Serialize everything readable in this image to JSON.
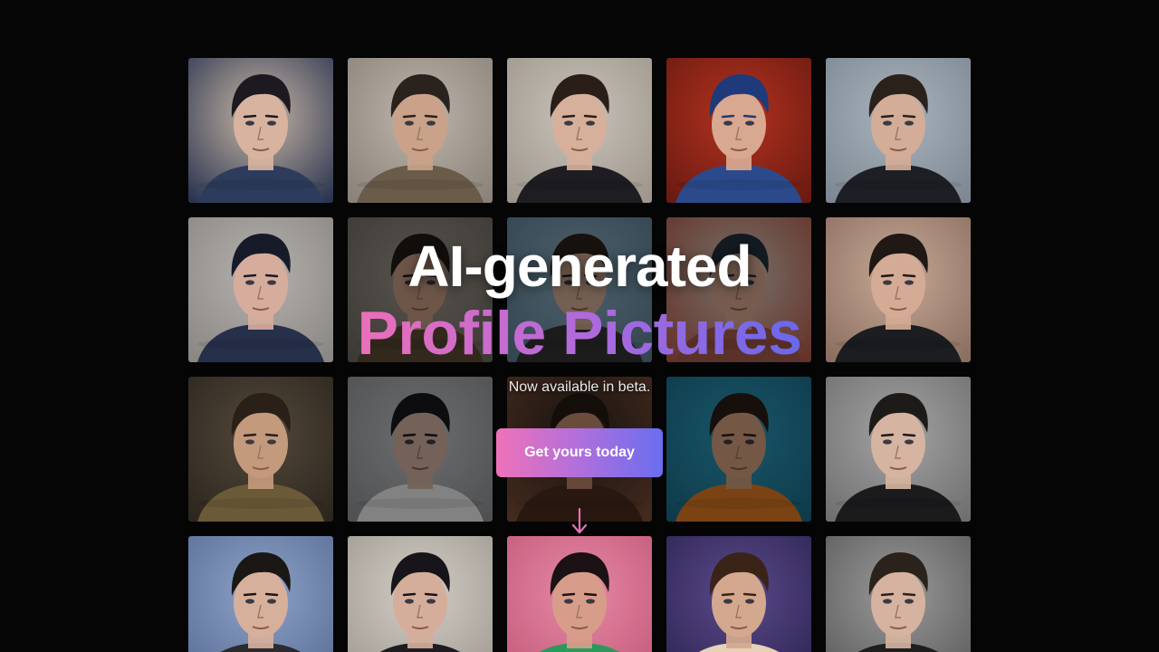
{
  "hero": {
    "title_line1": "AI-generated",
    "title_line2": "Profile Pictures",
    "subtitle": "Now available in beta.",
    "cta_label": "Get yours today",
    "arrow_icon": "arrow-down-icon",
    "gradient": [
      "#ec6fb9",
      "#b86ad8",
      "#6a68ec"
    ]
  },
  "portraits": [
    {
      "bg": "#c9b8a6",
      "bg2": "#2a3450",
      "skin": "#d8b4a0",
      "hair": "#1c1a20",
      "shirt": "#2d3c5c"
    },
    {
      "bg": "#bdb6ad",
      "bg2": "#8a8178",
      "skin": "#c9a289",
      "hair": "#2a221c",
      "shirt": "#6b5c4a"
    },
    {
      "bg": "#c8c2ba",
      "bg2": "#9e968c",
      "skin": "#d6b09a",
      "hair": "#2a1f18",
      "shirt": "#1e1e22"
    },
    {
      "bg": "#b3321e",
      "bg2": "#6a1a12",
      "skin": "#d9a890",
      "hair": "#1f3a7a",
      "shirt": "#2b4a8c"
    },
    {
      "bg": "#a9b3bd",
      "bg2": "#7d8792",
      "skin": "#d3ad98",
      "hair": "#2b211b",
      "shirt": "#1d1f24"
    },
    {
      "bg": "#b4b1ae",
      "bg2": "#8a8683",
      "skin": "#d6ad9c",
      "hair": "#171a28",
      "shirt": "#26304a"
    },
    {
      "bg": "#9f988f",
      "bg2": "#6e675f",
      "skin": "#c79c83",
      "hair": "#201a15",
      "shirt": "#5a4a33"
    },
    {
      "bg": "#8fb0c2",
      "bg2": "#5a7d92",
      "skin": "#d3ad95",
      "hair": "#2a2018",
      "shirt": "#333"
    },
    {
      "bg": "#d9cdbf",
      "bg2": "#b65a4a",
      "skin": "#d7a88f",
      "hair": "#23303c",
      "shirt": "#a65a4a"
    },
    {
      "bg": "#c7a896",
      "bg2": "#8a6e60",
      "skin": "#d4ab95",
      "hair": "#1f1814",
      "shirt": "#1c1d20"
    },
    {
      "bg": "#54483a",
      "bg2": "#2c261e",
      "skin": "#c49a7c",
      "hair": "#2a2017",
      "shirt": "#6b5a38"
    },
    {
      "bg": "#c4c6c8",
      "bg2": "#8e9194",
      "skin": "#d2b2a0",
      "hair": "#18181c",
      "shirt": "#ececec"
    },
    {
      "bg": "#2b221c",
      "bg2": "#7a4d36",
      "skin": "#c18a6e",
      "hair": "#241a14",
      "shirt": "#4a2c1e"
    },
    {
      "bg": "#2c9cbf",
      "bg2": "#1a6a86",
      "skin": "#d2a07e",
      "hair": "#2a1c14",
      "shirt": "#e07a22"
    },
    {
      "bg": "#a3a3a3",
      "bg2": "#6f6f6f",
      "skin": "#d6b4a2",
      "hair": "#1e1a18",
      "shirt": "#1b1b1d"
    },
    {
      "bg": "#8ea3c8",
      "bg2": "#5a6e96",
      "skin": "#d7b09c",
      "hair": "#1b1714",
      "shirt": "#2a2a30"
    },
    {
      "bg": "#d2cdc6",
      "bg2": "#a09a92",
      "skin": "#d4ae9b",
      "hair": "#17151a",
      "shirt": "#1d1d21"
    },
    {
      "bg": "#e58aa6",
      "bg2": "#c45a7a",
      "skin": "#d79d8a",
      "hair": "#1a1214",
      "shirt": "#2a9a5a"
    },
    {
      "bg": "#5a4a8c",
      "bg2": "#2e2552",
      "skin": "#d4a88e",
      "hair": "#3a2418",
      "shirt": "#e6d2b8"
    },
    {
      "bg": "#9a9a9a",
      "bg2": "#5c5c5c",
      "skin": "#d5b3a0",
      "hair": "#2b221b",
      "shirt": "#1e1e1e"
    }
  ]
}
